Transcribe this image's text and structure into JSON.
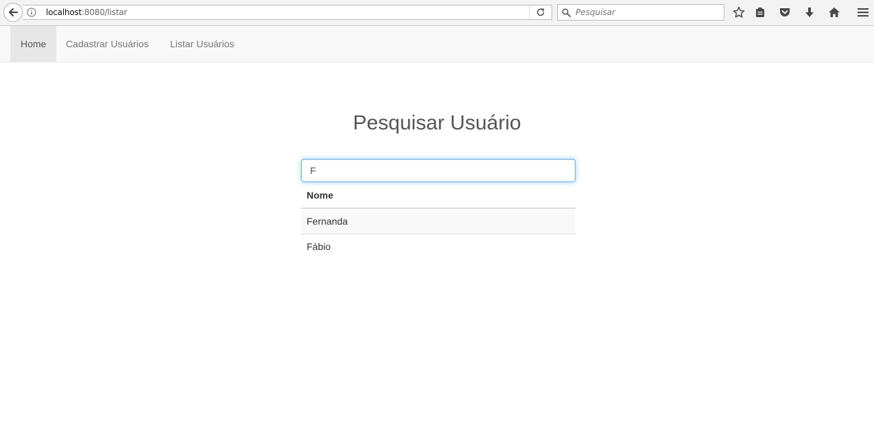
{
  "browser": {
    "url_host": "localhost",
    "url_path": ":8080/listar",
    "search_placeholder": "Pesquisar",
    "icons": {
      "back": "back-arrow-icon",
      "info": "info-icon",
      "reload": "reload-icon",
      "search": "search-icon",
      "bookmark": "star-icon",
      "reading_list": "clipboard-icon",
      "pocket": "pocket-icon",
      "downloads": "download-arrow-icon",
      "home": "home-icon",
      "menu": "hamburger-menu-icon"
    }
  },
  "navbar": {
    "items": [
      {
        "label": "Home",
        "active": true
      },
      {
        "label": "Cadastrar Usuários",
        "active": false
      },
      {
        "label": "Listar Usuários",
        "active": false
      }
    ]
  },
  "main": {
    "title": "Pesquisar Usuário",
    "search_value": "F",
    "table": {
      "header": "Nome",
      "rows": [
        "Fernanda",
        "Fábio"
      ]
    }
  },
  "colors": {
    "navbar_bg": "#f8f8f8",
    "nav_active_bg": "#e7e7e7",
    "input_focus_border": "#66afe9"
  }
}
